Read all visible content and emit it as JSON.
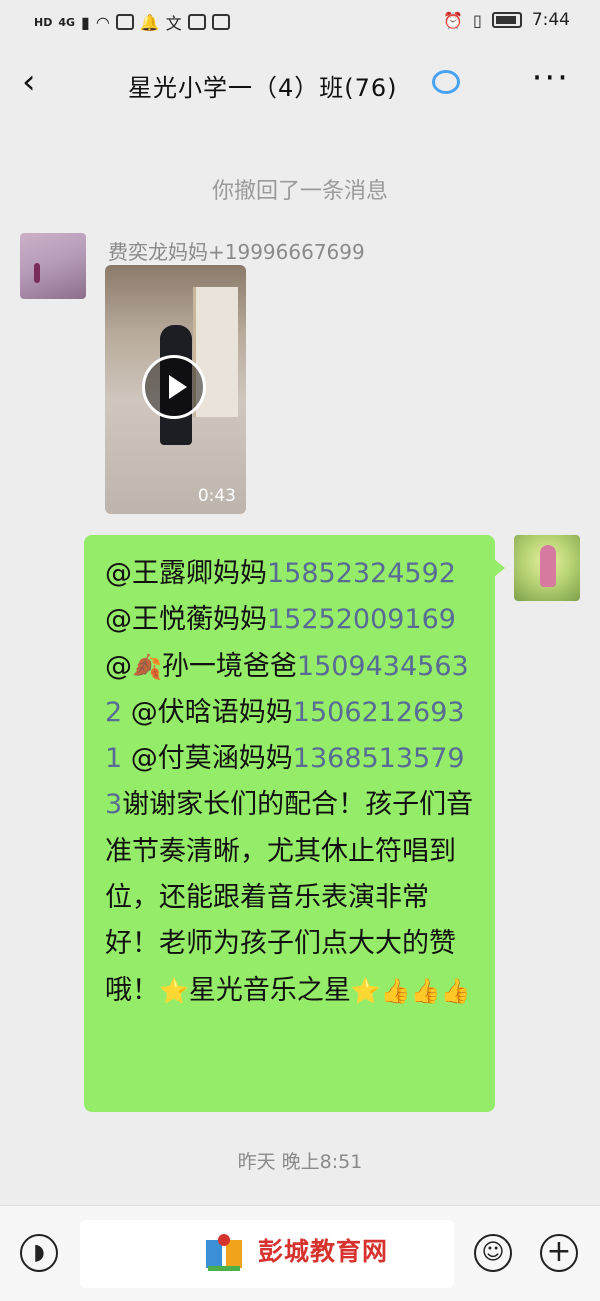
{
  "status_bar": {
    "left_icons": [
      "HD",
      "4G",
      "signal-icon",
      "wifi-icon",
      "sim-icon",
      "bell-icon",
      "translate-icon",
      "mail-icon",
      "upload-icon"
    ],
    "hd_label": "HD",
    "network_label": "4G",
    "time": "7:44"
  },
  "header": {
    "back_glyph": "‹",
    "title": "星光小学一（4）班(76)",
    "more_glyph": "···"
  },
  "recall_notice": "你撤回了一条消息",
  "message_1": {
    "sender": "费奕龙妈妈+19996667699",
    "video_duration": "0:43"
  },
  "message_2": {
    "segments": [
      {
        "text": "@王露卿妈妈",
        "type": "text"
      },
      {
        "text": "15852324592",
        "type": "phone"
      },
      {
        "text": " @王悦蘅妈妈",
        "type": "text"
      },
      {
        "text": "15252009169",
        "type": "phone"
      },
      {
        "text": " @",
        "type": "text"
      },
      {
        "text": "🍂",
        "type": "emoji"
      },
      {
        "text": "孙一境爸爸",
        "type": "text"
      },
      {
        "text": "15094345632",
        "type": "phone"
      },
      {
        "text": "  @伏晗语妈妈",
        "type": "text"
      },
      {
        "text": "15062126931",
        "type": "phone"
      },
      {
        "text": " @付莫涵妈妈",
        "type": "text"
      },
      {
        "text": "13685135793",
        "type": "phone"
      },
      {
        "text": "谢谢家长们的配合！孩子们音准节奏清晰，尤其休止符唱到位，还能跟着音乐表演非常好！老师为孩子们点大大的赞哦！",
        "type": "text"
      },
      {
        "text": "⭐",
        "type": "emoji"
      },
      {
        "text": "星光音乐之星",
        "type": "text"
      },
      {
        "text": "⭐👍👍👍",
        "type": "emoji"
      }
    ]
  },
  "timestamp": "昨天 晚上8:51",
  "bottom_bar": {
    "watermark": "彭城教育网"
  },
  "colors": {
    "bubble_green": "#95ec69",
    "phone_link": "#576b95",
    "background": "#ededed"
  }
}
